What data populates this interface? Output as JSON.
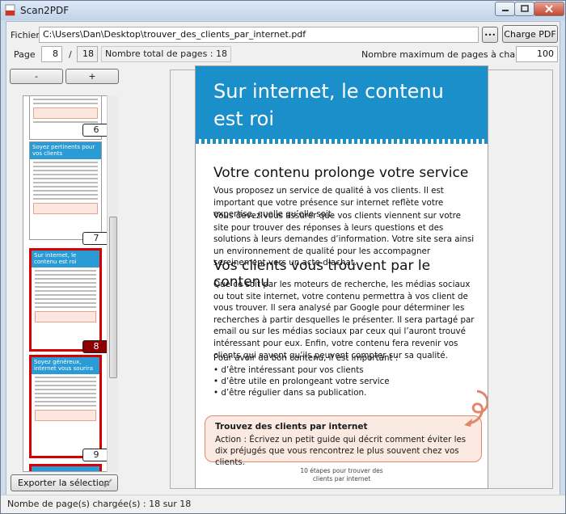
{
  "window": {
    "title": "Scan2PDF",
    "icons": {
      "app": "pdf-app-icon",
      "min": "minimize-icon",
      "max": "maximize-icon",
      "close": "close-icon"
    }
  },
  "file": {
    "label": "Fichier",
    "path": "C:\\Users\\Dan\\Desktop\\trouver_des_clients_par_internet.pdf",
    "browse_label": "•••",
    "load_label": "Charge PDF"
  },
  "pager": {
    "label": "Page",
    "current": "8",
    "separator": "/",
    "total": "18",
    "total_label": "Nombre total de pages : 18",
    "max_label": "Nombre maximum de pages à charger",
    "max_value": "100"
  },
  "zoom": {
    "minus": "-",
    "plus": "+"
  },
  "thumbnails": [
    {
      "number": "6",
      "title": "",
      "selected": false
    },
    {
      "number": "7",
      "title": "Soyez pertinents pour vos clients",
      "selected": false
    },
    {
      "number": "8",
      "title": "Sur internet, le contenu est roi",
      "selected": true
    },
    {
      "number": "9",
      "title": "Soyez généreux, internet vous sourira",
      "selected": true
    }
  ],
  "export": {
    "label": "Exporter la sélection",
    "icon": "checkmark-icon"
  },
  "preview": {
    "banner_title": "Sur internet, le contenu est roi",
    "h1": "Votre contenu prolonge votre service",
    "p1": "Vous proposez un service de qualité à vos clients. Il est important que votre présence sur internet reflète votre expertise, quelle qu’elle soit.",
    "p2": "Vous devez vous assurer que vos clients viennent sur votre site pour trouver des réponses à leurs questions et des solutions à leurs demandes d’information. Votre site sera ainsi un environnement de qualité pour les accompagner sereinement vers un acte d’achat.",
    "h2": "Vos clients vous trouvent par le contenu",
    "p3": "Que ce soit par les moteurs de recherche, les médias sociaux ou tout site internet, votre contenu permettra à vos client de vous trouver. Il sera analysé par Google pour déterminer les recherches à partir desquelles le présenter. Il sera partagé par email ou sur les médias sociaux par ceux qui l’auront trouvé intéressant pour eux. Enfin, votre contenu fera revenir vos clients qui savent qu’ils peuvent compter sur sa qualité.",
    "p4": "Pour avoir du bon contenu, il est important :",
    "bullets": [
      "• d’être intéressant pour vos clients",
      "• d’être utile en prolongeant votre service",
      "• d’être régulier dans sa publication."
    ],
    "callout_title": "Trouvez des clients par internet",
    "callout_text": "Action : Écrivez un petit guide qui décrit comment éviter les dix préjugés que vous rencontrez le plus souvent chez vos clients.",
    "footer_line1": "10 étapes pour trouver des",
    "footer_line2": "clients par internet",
    "accent_color": "#1b8fc9",
    "callout_color": "#e2876a"
  },
  "status": {
    "text": "Nombe de page(s) chargée(s) : 18 sur 18"
  }
}
